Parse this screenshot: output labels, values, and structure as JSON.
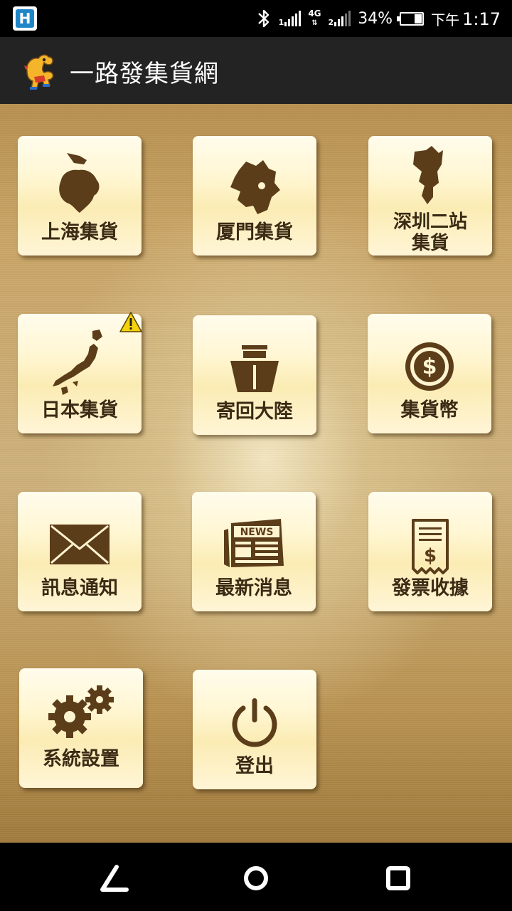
{
  "status_bar": {
    "network_type": "4G",
    "sim2_label": "2",
    "battery_text": "34%",
    "battery_level_pct": 34,
    "ampm": "下午",
    "time": "1:17"
  },
  "app_bar": {
    "title": "一路發集貨網"
  },
  "tiles": [
    {
      "label": "上海集貨",
      "icon": "shanghai-map-icon"
    },
    {
      "label": "厦門集貨",
      "icon": "xiamen-map-icon"
    },
    {
      "label_line1": "深圳二站",
      "label_line2": "集貨",
      "icon": "shenzhen-map-icon"
    },
    {
      "label": "日本集貨",
      "icon": "japan-map-icon",
      "badge": "warning-icon"
    },
    {
      "label": "寄回大陸",
      "icon": "ship-icon"
    },
    {
      "label": "集貨幣",
      "icon": "dollar-coin-icon"
    },
    {
      "label": "訊息通知",
      "icon": "envelope-icon"
    },
    {
      "label": "最新消息",
      "icon": "newspaper-icon",
      "icon_text": "NEWS"
    },
    {
      "label": "發票收據",
      "icon": "receipt-icon",
      "icon_text": "$"
    },
    {
      "label": "系統設置",
      "icon": "gears-icon"
    },
    {
      "label": "登出",
      "icon": "power-icon"
    }
  ],
  "colors": {
    "icon_brown": "#5c3d19",
    "label_brown": "#3b2a14",
    "app_bar_bg": "#232323"
  }
}
